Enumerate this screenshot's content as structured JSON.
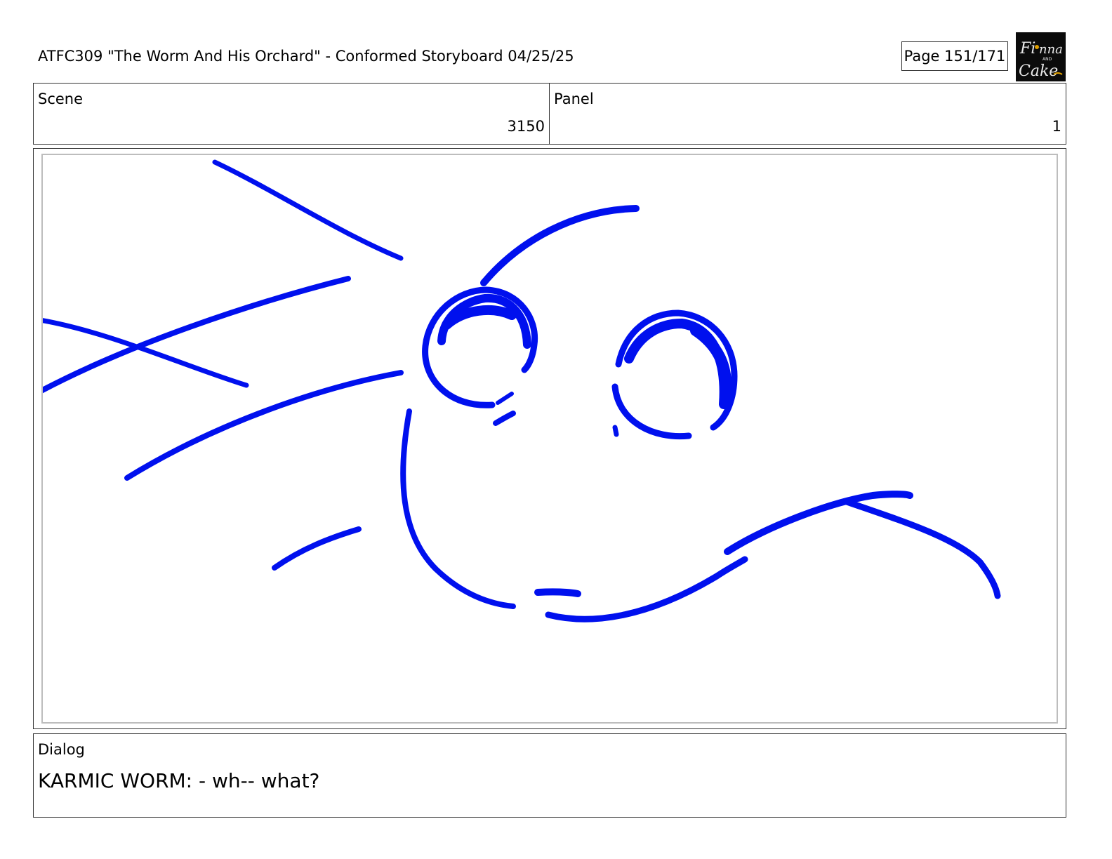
{
  "header": {
    "title": "ATFC309 \"The Worm And His Orchard\" - Conformed Storyboard 04/25/25",
    "page": "Page 151/171"
  },
  "logo": {
    "text_lines": [
      "Fionna",
      "AND",
      "Cake"
    ],
    "colors": {
      "background": "#0b0b0b",
      "letters": "#e8e8e8",
      "accent": "#e0a000"
    }
  },
  "info": {
    "scene_label": "Scene",
    "scene_value": "3150",
    "panel_label": "Panel",
    "panel_value": "1"
  },
  "sketch": {
    "stroke_color": "#0010ee",
    "frame_border_color": "#bdbdbd"
  },
  "dialog": {
    "label": "Dialog",
    "text": "KARMIC WORM: - wh-- what?"
  }
}
